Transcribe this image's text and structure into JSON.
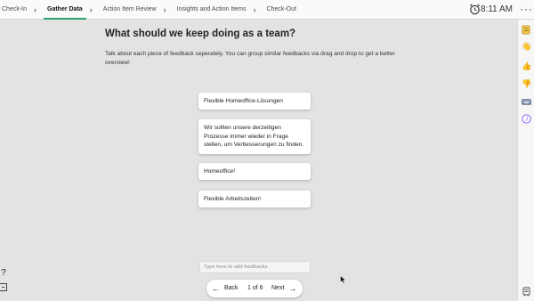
{
  "nav": {
    "steps": [
      "Check-In",
      "Gather Data",
      "Action Item Review",
      "Insights and Action Items",
      "Check-Out"
    ],
    "active": "Gather Data"
  },
  "header": {
    "time": "8:11 AM",
    "menu_icon": "more-horizontal-icon",
    "clock_icon": "alarm-clock-icon"
  },
  "main": {
    "title": "What should we keep doing as a team?",
    "description": "Talk about each piece of feedback seperately. You can group similar feedbacks via drag and drop to get a better overview!",
    "cards": [
      "Flexible Homeoffice-Lösungen",
      "Wir sollten unsere derzeitigen Prozesse immer wieder in Frage stellen, um Verbesserungen zu finden.",
      "Homeoffice!",
      "Flexible Arbeitszeiten!"
    ],
    "input_placeholder": "Type here to add feedbacks"
  },
  "pager": {
    "back_label": "Back",
    "count": "1 of 6",
    "next_label": "Next"
  },
  "left": {
    "help": "?"
  },
  "rail": {
    "icons": [
      "notes-icon",
      "hand-wave-icon",
      "thumbs-up-icon",
      "thumbs-down-icon",
      "keyboard-icon",
      "user-avatar-icon",
      "board-icon"
    ],
    "avatar_letter": "J",
    "accent": "#8a5cf6"
  },
  "colors": {
    "active_step": "#2aa36b",
    "background": "#e3e3e3"
  }
}
